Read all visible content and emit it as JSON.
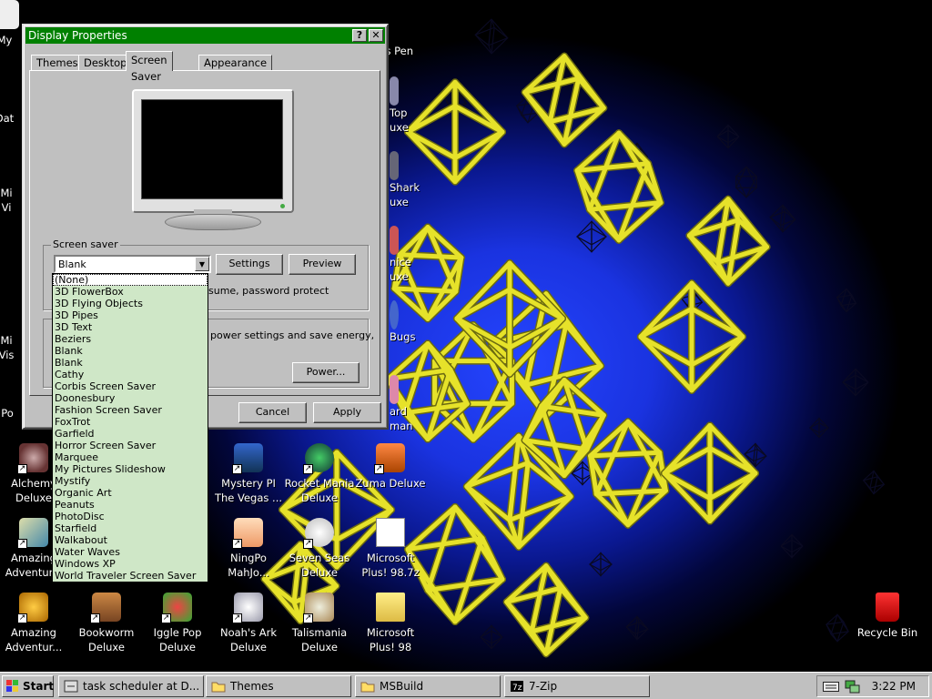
{
  "window": {
    "title": "Display Properties",
    "help_btn": "?",
    "close_btn": "✕",
    "tabs": [
      "Themes",
      "Desktop",
      "Screen Saver",
      "Appearance"
    ],
    "active_tab": "Screen Saver"
  },
  "screensaver": {
    "group_label": "Screen saver",
    "selected": "Blank",
    "settings_btn": "Settings",
    "preview_btn": "Preview",
    "resume_text": "sume, password protect",
    "power_text": "power settings and save energy,",
    "power_btn": "Power...",
    "options": [
      "(None)",
      "3D FlowerBox",
      "3D Flying Objects",
      "3D Pipes",
      "3D Text",
      "Beziers",
      "Blank",
      "Blank",
      "Cathy",
      "Corbis Screen Saver",
      "Doonesbury",
      "Fashion Screen Saver",
      "FoxTrot",
      "Garfield",
      "Horror Screen Saver",
      "Marquee",
      "My Pictures Slideshow",
      "Mystify",
      "Organic Art",
      "Peanuts",
      "PhotoDisc",
      "Starfield",
      "Walkabout",
      "Water Waves",
      "Windows XP",
      "World Traveler Screen Saver"
    ]
  },
  "dialog_buttons": {
    "cancel": "Cancel",
    "apply": "Apply"
  },
  "desktop_icons": [
    {
      "label": "My",
      "icon": "my-computer-icon"
    },
    {
      "label": "Dat",
      "icon": "data-icon"
    },
    {
      "label": "Mi\nVi",
      "icon": "app-icon"
    },
    {
      "label": "Mi\nVis",
      "icon": "app-icon"
    },
    {
      "label": "Po",
      "icon": "app-icon"
    },
    {
      "label": "Alchemy\nDeluxe",
      "icon": "alchemy-icon"
    },
    {
      "label": "Amazing\nAdventur...",
      "icon": "amazing-adventures-icon"
    },
    {
      "label": "Amazing\nAdventur...",
      "icon": "amazing-adventures-icon"
    },
    {
      "label": "Bookworm\nDeluxe",
      "icon": "bookworm-icon"
    },
    {
      "label": "Iggle Pop\nDeluxe",
      "icon": "iggle-pop-icon"
    },
    {
      "label": "Noah's Ark\nDeluxe",
      "icon": "noahs-ark-icon"
    },
    {
      "label": "Talismania\nDeluxe",
      "icon": "talismania-icon"
    },
    {
      "label": "Microsoft\nPlus! 98",
      "icon": "folder-icon"
    },
    {
      "label": "Mystery PI\nThe Vegas ...",
      "icon": "mystery-pi-icon"
    },
    {
      "label": "Rocket Mania\nDeluxe",
      "icon": "rocket-mania-icon"
    },
    {
      "label": "Zuma Deluxe",
      "icon": "zuma-icon"
    },
    {
      "label": "NingPo\nMahJo...",
      "icon": "ningpo-icon"
    },
    {
      "label": "Seven Seas\nDeluxe",
      "icon": "seven-seas-icon"
    },
    {
      "label": "Microsoft\nPlus! 98.7z",
      "icon": "archive-icon"
    },
    {
      "label": "Recycle Bin",
      "icon": "recycle-bin-icon"
    },
    {
      "label": "ne\nd's Pen",
      "icon": "app-icon"
    },
    {
      "label": "Top\nuxe",
      "icon": "app-icon"
    },
    {
      "label": "Shark\nuxe",
      "icon": "shark-icon"
    },
    {
      "label": "nice\nuxe",
      "icon": "app-icon"
    },
    {
      "label": "Bugs",
      "icon": "bugs-icon"
    },
    {
      "label": "ard\nman",
      "icon": "app-icon"
    }
  ],
  "taskbar": {
    "start_label": "Start",
    "tasks": [
      "task scheduler at D...",
      "Themes",
      "MSBuild",
      "7-Zip"
    ],
    "clock": "3:22 PM"
  },
  "colors": {
    "titlebar": "#008000",
    "window_face": "#c0c0c0",
    "dropdown_bg": "#cfe7c7",
    "desktop_blue": "#1a33e0",
    "octahedron_yellow": "#e6e22a"
  }
}
